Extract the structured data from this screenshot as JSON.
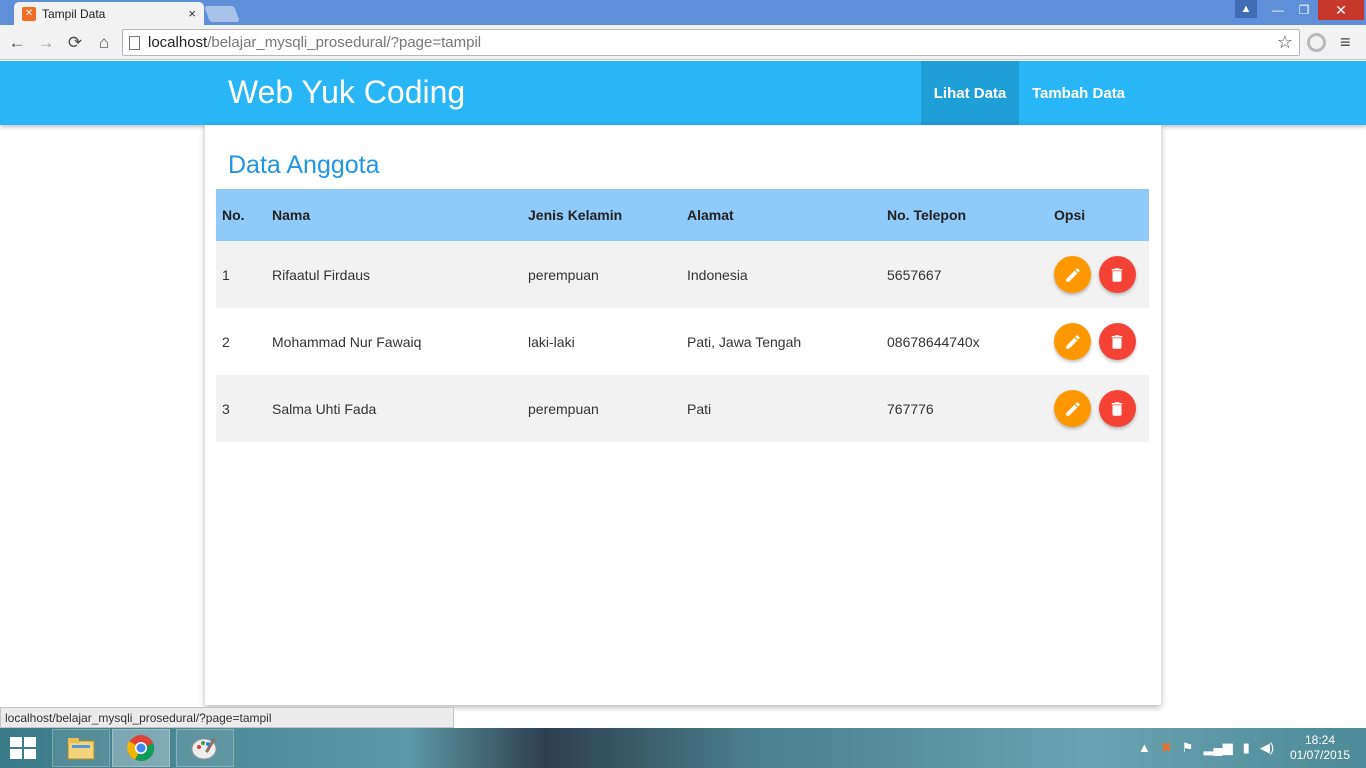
{
  "browser": {
    "tab_title": "Tampil Data",
    "tab_close": "×",
    "url_host": "localhost",
    "url_path": "/belajar_mysqli_prosedural/?page=tampil",
    "status_url": "localhost/belajar_mysqli_prosedural/?page=tampil"
  },
  "navbar": {
    "brand": "Web Yuk Coding",
    "items": [
      {
        "label": "Lihat Data",
        "active": true
      },
      {
        "label": "Tambah Data",
        "active": false
      }
    ]
  },
  "main": {
    "title": "Data Anggota",
    "columns": [
      "No.",
      "Nama",
      "Jenis Kelamin",
      "Alamat",
      "No. Telepon",
      "Opsi"
    ],
    "rows": [
      {
        "no": "1",
        "nama": "Rifaatul Firdaus",
        "jenis_kelamin": "perempuan",
        "alamat": "Indonesia",
        "telepon": "5657667"
      },
      {
        "no": "2",
        "nama": "Mohammad Nur Fawaiq",
        "jenis_kelamin": "laki-laki",
        "alamat": "Pati, Jawa Tengah",
        "telepon": "08678644740x"
      },
      {
        "no": "3",
        "nama": "Salma Uhti Fada",
        "jenis_kelamin": "perempuan",
        "alamat": "Pati",
        "telepon": "767776"
      }
    ]
  },
  "taskbar": {
    "time": "18:24",
    "date": "01/07/2015"
  },
  "colors": {
    "navbar": "#29b6f6",
    "nav_active": "#1e9fd8",
    "table_header": "#90caf9",
    "title": "#2196e3",
    "edit_button": "#ff9800",
    "delete_button": "#f44336"
  },
  "icons": [
    "back-arrow-icon",
    "forward-arrow-icon",
    "reload-icon",
    "home-icon",
    "star-icon",
    "menu-icon",
    "pencil-icon",
    "trash-icon",
    "windows-start-icon",
    "chrome-icon",
    "file-explorer-icon",
    "paint-icon"
  ]
}
